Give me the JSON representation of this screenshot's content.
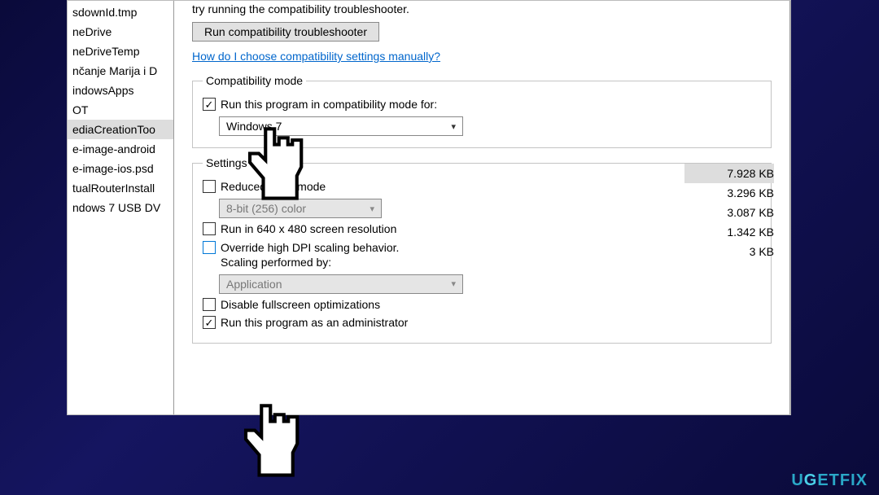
{
  "files": {
    "items": [
      {
        "name": "sdownId.tmp"
      },
      {
        "name": "neDrive"
      },
      {
        "name": "neDriveTemp"
      },
      {
        "name": "nčanje Marija i D"
      },
      {
        "name": "indowsApps"
      },
      {
        "name": "OT"
      },
      {
        "name": "ediaCreationToo",
        "selected": true
      },
      {
        "name": "e-image-android"
      },
      {
        "name": "e-image-ios.psd"
      },
      {
        "name": "tualRouterInstall"
      },
      {
        "name": "ndows 7 USB DV"
      }
    ],
    "sizes": [
      {
        "val": "7.928 KB",
        "selected": true
      },
      {
        "val": "3.296 KB"
      },
      {
        "val": "3.087 KB"
      },
      {
        "val": "1.342 KB"
      },
      {
        "val": "3 KB"
      }
    ]
  },
  "props": {
    "hint": "try running the compatibility troubleshooter.",
    "troubleshooter_btn": "Run compatibility troubleshooter",
    "help_link": "How do I choose compatibility settings manually?",
    "compat_legend": "Compatibility mode",
    "compat_check_label": "Run this program in compatibility mode for:",
    "compat_os": "Windows 7",
    "settings_legend": "Settings",
    "reduced_color_label": "Reduced color mode",
    "color_option": "8-bit (256) color",
    "res_label": "Run in 640 x 480 screen resolution",
    "dpi_label_1": "Override high DPI scaling behavior.",
    "dpi_label_2": "Scaling performed by:",
    "dpi_option": "Application",
    "fullscreen_label": "Disable fullscreen optimizations",
    "admin_label": "Run this program as an administrator"
  },
  "watermark": "UGETFIX"
}
